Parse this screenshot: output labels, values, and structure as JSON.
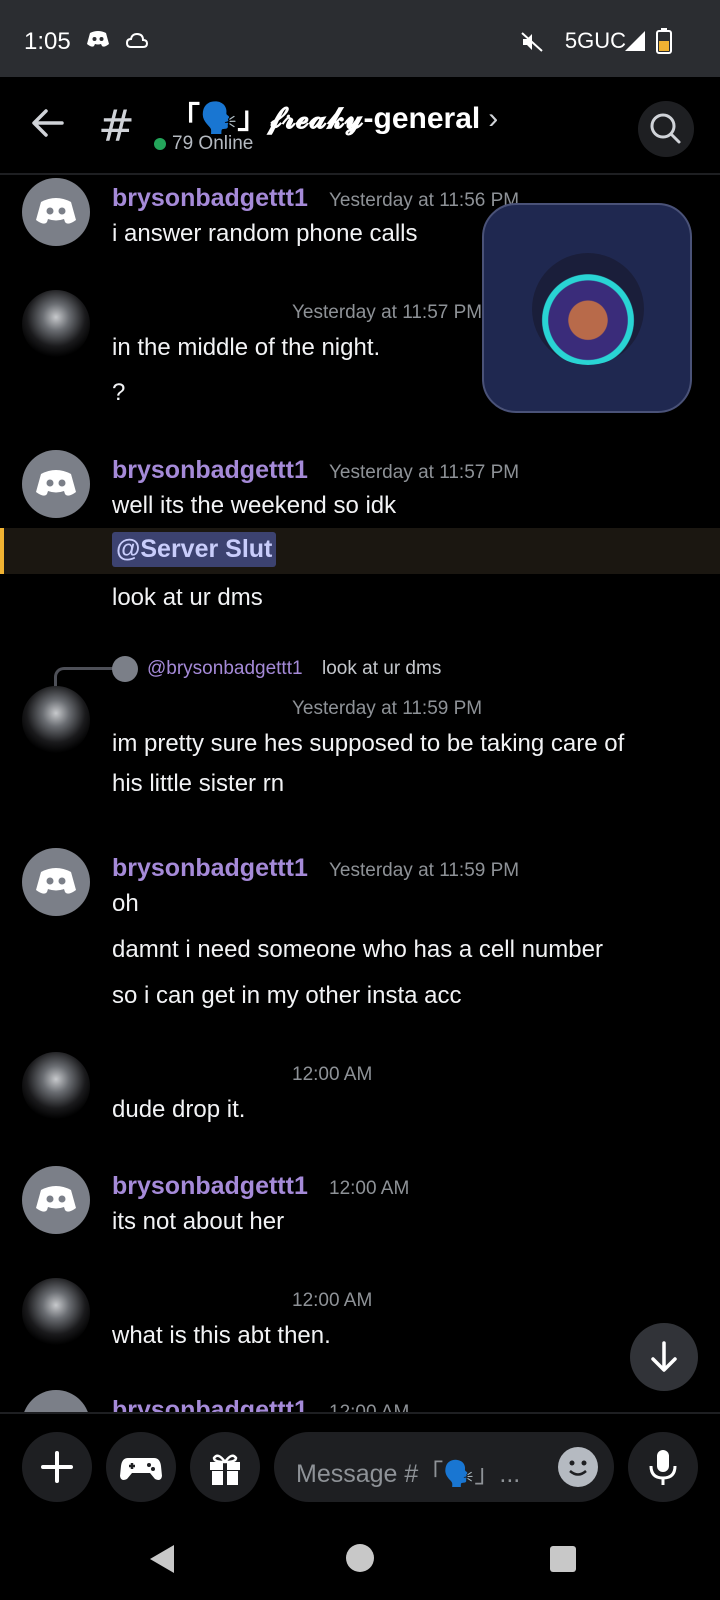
{
  "status_bar": {
    "time": "1:05",
    "network": "5GUC"
  },
  "header": {
    "channel_name": "「🗣️」𝓯𝓻𝓮𝓪𝓴𝔂-general",
    "online": "79 Online"
  },
  "messages": [
    {
      "author": "brysonbadgettt1",
      "time": "Yesterday at 11:56 PM",
      "lines": [
        "i answer random phone calls"
      ]
    },
    {
      "author": "",
      "time": "Yesterday at 11:57 PM",
      "lines": [
        "in the middle of the night.",
        "?"
      ]
    },
    {
      "author": "brysonbadgettt1",
      "time": "Yesterday at 11:57 PM",
      "lines": [
        "well its the weekend so idk"
      ],
      "mention": "@Server Slut",
      "after_mention": "look at ur dms"
    },
    {
      "reply_author": "@brysonbadgettt1",
      "reply_text": "look at ur dms",
      "author": "",
      "time": "Yesterday at 11:59 PM",
      "lines": [
        "im pretty sure hes supposed to be taking care of",
        "his little sister rn"
      ]
    },
    {
      "author": "brysonbadgettt1",
      "time": "Yesterday at 11:59 PM",
      "lines": [
        "oh",
        "damnt i need someone who has a cell number",
        "so i can get in my other insta acc"
      ]
    },
    {
      "author": "",
      "time": "12:00 AM",
      "lines": [
        "dude drop it."
      ]
    },
    {
      "author": "brysonbadgettt1",
      "time": "12:00 AM",
      "lines": [
        "its not about her"
      ]
    },
    {
      "author": "",
      "time": "12:00 AM",
      "lines": [
        "what is this abt then."
      ]
    },
    {
      "author": "brysonbadgettt1",
      "time": "12:00 AM",
      "lines": []
    }
  ],
  "composer": {
    "placeholder": "Message #「🗣️」..."
  },
  "colors": {
    "accent_author": "#a58ad8",
    "mention_bar": "#f0b232",
    "online_dot": "#23a55a"
  }
}
